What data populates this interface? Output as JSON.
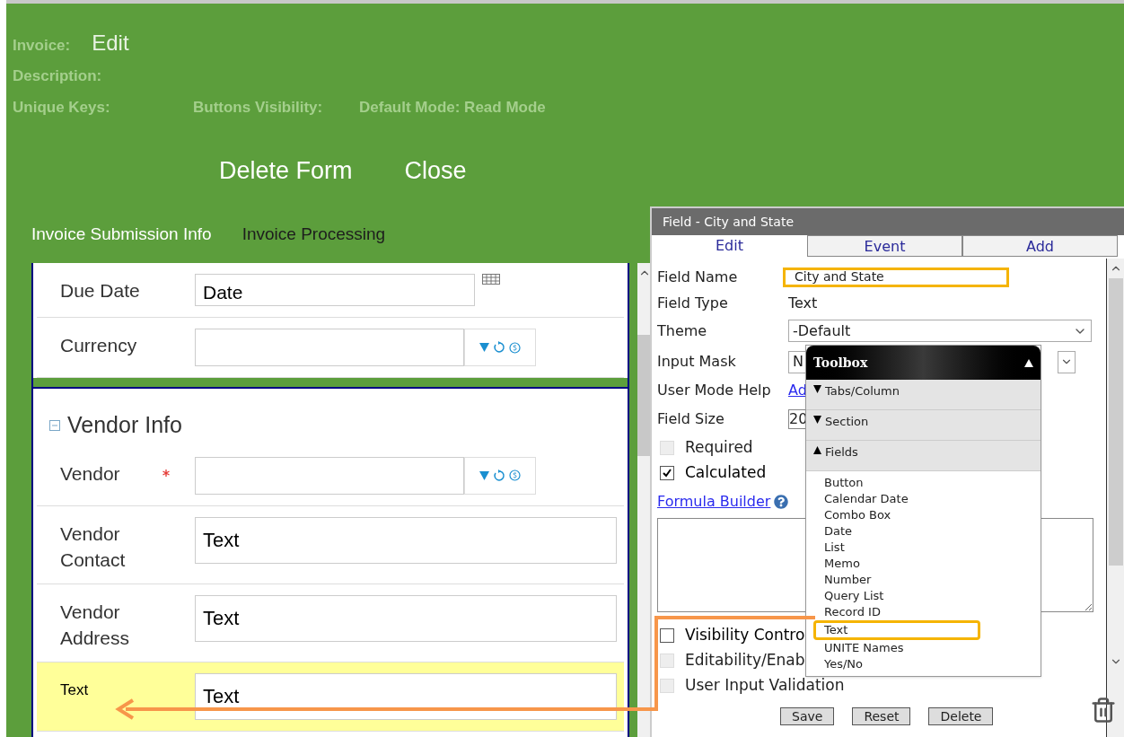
{
  "header": {
    "invoice_label": "Invoice:",
    "invoice_value": "Edit",
    "description_label": "Description:",
    "unique_keys_label": "Unique Keys:",
    "buttons_visibility_label": "Buttons Visibility:",
    "default_mode": "Default Mode: Read Mode"
  },
  "actions": [
    "Delete Form",
    "Close"
  ],
  "form_tabs": [
    {
      "label": "Invoice Submission Info",
      "selected": true
    },
    {
      "label": "Invoice Processing",
      "selected": false
    }
  ],
  "form_rows_top": [
    {
      "kind": "date",
      "label": "Due Date",
      "value": "Date"
    },
    {
      "kind": "combo",
      "label": "Currency"
    }
  ],
  "section": {
    "title": "Vendor Info",
    "expanded": true,
    "rows": [
      {
        "kind": "combo",
        "label": "Vendor",
        "required": true,
        "highlighted": false
      },
      {
        "kind": "text",
        "label": "Vendor Contact",
        "required": false,
        "value": "Text",
        "highlighted": false
      },
      {
        "kind": "text",
        "label": "Vendor Address",
        "required": false,
        "value": "Text",
        "highlighted": false
      },
      {
        "kind": "text",
        "label": "Text",
        "required": false,
        "value": "Text",
        "highlighted": true
      }
    ]
  },
  "panel": {
    "title": "Field - City and State",
    "tabs": [
      {
        "label": "Edit",
        "selected": true
      },
      {
        "label": "Event",
        "selected": false
      },
      {
        "label": "Add",
        "selected": false
      }
    ],
    "field_name": {
      "label": "Field Name",
      "value": "City and State",
      "highlighted": true
    },
    "field_type": {
      "label": "Field Type",
      "value": "Text"
    },
    "theme": {
      "label": "Theme",
      "value": "-Default"
    },
    "input_mask": {
      "label": "Input Mask",
      "value": "N"
    },
    "user_mode_help": {
      "label": "User Mode Help",
      "link": "Ad"
    },
    "field_size": {
      "label": "Field Size",
      "value": "20"
    },
    "checks_top": [
      {
        "label": "Required",
        "checked": false,
        "disabled": true
      },
      {
        "label": "Calculated",
        "checked": true,
        "disabled": false
      }
    ],
    "formula_builder": "Formula Builder",
    "checks_bottom": [
      {
        "label": "Visibility Contro",
        "checked": false,
        "disabled": false
      },
      {
        "label": "Editability/Enab",
        "checked": false,
        "disabled": true
      },
      {
        "label": "User Input Validation",
        "checked": false,
        "disabled": true
      }
    ],
    "buttons": [
      "Save",
      "Reset",
      "Delete"
    ]
  },
  "toolbox": {
    "title": "Toolbox",
    "expanded": true,
    "groups": [
      {
        "label": "Tabs/Column",
        "expanded": false
      },
      {
        "label": "Section",
        "expanded": false
      },
      {
        "label": "Fields",
        "expanded": true
      }
    ],
    "items": [
      {
        "label": "Button",
        "highlighted": false
      },
      {
        "label": "Calendar Date",
        "highlighted": false
      },
      {
        "label": "Combo Box",
        "highlighted": false
      },
      {
        "label": "Date",
        "highlighted": false
      },
      {
        "label": "List",
        "highlighted": false
      },
      {
        "label": "Memo",
        "highlighted": false
      },
      {
        "label": "Number",
        "highlighted": false
      },
      {
        "label": "Query List",
        "highlighted": false
      },
      {
        "label": "Record ID",
        "highlighted": false
      },
      {
        "label": "Text",
        "highlighted": true
      },
      {
        "label": "UNITE Names",
        "highlighted": false
      },
      {
        "label": "Yes/No",
        "highlighted": false
      }
    ]
  }
}
